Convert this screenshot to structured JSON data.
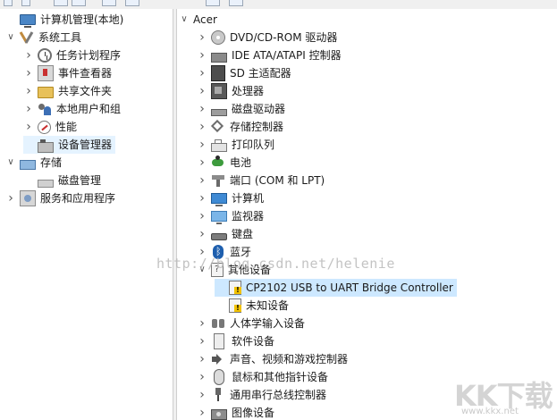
{
  "left_tree": [
    {
      "label": "计算机管理(本地)",
      "expander": "",
      "icon": "computer-icon",
      "level": 0
    },
    {
      "label": "系统工具",
      "expander": "open",
      "icon": "tools-icon",
      "level": 0
    },
    {
      "label": "任务计划程序",
      "expander": "closed",
      "icon": "clock-icon",
      "level": 1
    },
    {
      "label": "事件查看器",
      "expander": "closed",
      "icon": "event-viewer-icon",
      "level": 1
    },
    {
      "label": "共享文件夹",
      "expander": "closed",
      "icon": "shared-folder-icon",
      "level": 1
    },
    {
      "label": "本地用户和组",
      "expander": "closed",
      "icon": "users-icon",
      "level": 1
    },
    {
      "label": "性能",
      "expander": "closed",
      "icon": "performance-icon",
      "level": 1
    },
    {
      "label": "设备管理器",
      "expander": "",
      "icon": "device-manager-icon",
      "level": 1,
      "selected": true
    },
    {
      "label": "存储",
      "expander": "open",
      "icon": "storage-icon",
      "level": 0
    },
    {
      "label": "磁盘管理",
      "expander": "",
      "icon": "disk-management-icon",
      "level": 1
    },
    {
      "label": "服务和应用程序",
      "expander": "closed",
      "icon": "services-icon",
      "level": 0
    }
  ],
  "right_tree": [
    {
      "label": "Acer",
      "expander": "open",
      "icon": "",
      "level": 0
    },
    {
      "label": "DVD/CD-ROM 驱动器",
      "expander": "closed",
      "icon": "cdrom-icon",
      "level": 1
    },
    {
      "label": "IDE ATA/ATAPI 控制器",
      "expander": "closed",
      "icon": "ide-controller-icon",
      "level": 1
    },
    {
      "label": "SD 主适配器",
      "expander": "closed",
      "icon": "sd-adapter-icon",
      "level": 1
    },
    {
      "label": "处理器",
      "expander": "closed",
      "icon": "processor-icon",
      "level": 1
    },
    {
      "label": "磁盘驱动器",
      "expander": "closed",
      "icon": "disk-drive-icon",
      "level": 1
    },
    {
      "label": "存储控制器",
      "expander": "closed",
      "icon": "storage-controller-icon",
      "level": 1
    },
    {
      "label": "打印队列",
      "expander": "closed",
      "icon": "printer-icon",
      "level": 1
    },
    {
      "label": "电池",
      "expander": "closed",
      "icon": "battery-icon",
      "level": 1
    },
    {
      "label": "端口 (COM 和 LPT)",
      "expander": "closed",
      "icon": "port-icon",
      "level": 1
    },
    {
      "label": "计算机",
      "expander": "closed",
      "icon": "pc-icon",
      "level": 1
    },
    {
      "label": "监视器",
      "expander": "closed",
      "icon": "monitor-icon",
      "level": 1
    },
    {
      "label": "键盘",
      "expander": "closed",
      "icon": "keyboard-icon",
      "level": 1
    },
    {
      "label": "蓝牙",
      "expander": "closed",
      "icon": "bluetooth-icon",
      "level": 1
    },
    {
      "label": "其他设备",
      "expander": "open",
      "icon": "other-devices-icon",
      "level": 1
    },
    {
      "label": "CP2102 USB to UART Bridge Controller",
      "expander": "",
      "icon": "warning-device-icon",
      "level": 2,
      "selected": true
    },
    {
      "label": "未知设备",
      "expander": "",
      "icon": "warning-device-icon",
      "level": 2
    },
    {
      "label": "人体学输入设备",
      "expander": "closed",
      "icon": "hid-icon",
      "level": 1
    },
    {
      "label": "软件设备",
      "expander": "closed",
      "icon": "software-device-icon",
      "level": 1
    },
    {
      "label": "声音、视频和游戏控制器",
      "expander": "closed",
      "icon": "sound-icon",
      "level": 1
    },
    {
      "label": "鼠标和其他指针设备",
      "expander": "closed",
      "icon": "mouse-icon",
      "level": 1
    },
    {
      "label": "通用串行总线控制器",
      "expander": "closed",
      "icon": "usb-icon",
      "level": 1
    },
    {
      "label": "图像设备",
      "expander": "closed",
      "icon": "imaging-icon",
      "level": 1
    }
  ],
  "watermark": {
    "text": "http://blog.csdn.net/helenie"
  },
  "logo": {
    "big": "KK下载",
    "small": "www.kkx.net"
  },
  "colors": {
    "selection": "#cde8ff",
    "selection_light": "#e5f3ff",
    "splitter": "#f0f0f0"
  }
}
